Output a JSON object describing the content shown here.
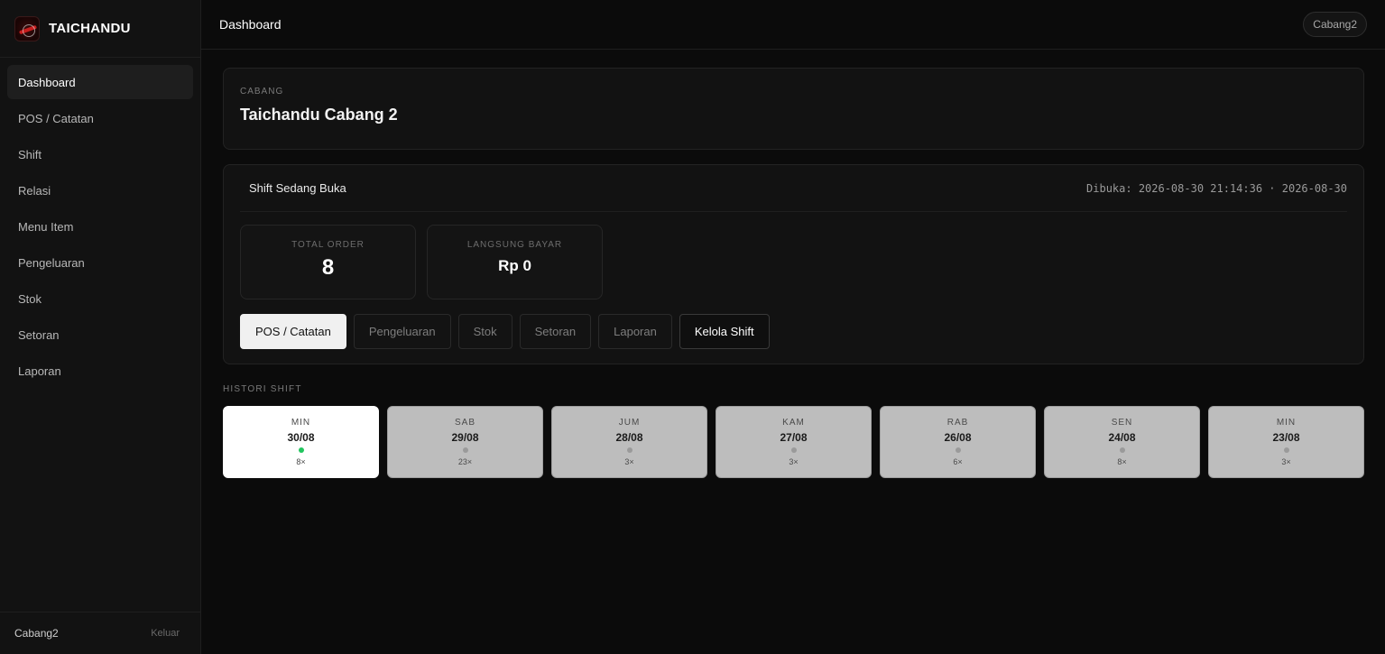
{
  "brand": {
    "name": "TAICHANDU"
  },
  "sidebar": {
    "items": [
      {
        "label": "Dashboard",
        "active": true
      },
      {
        "label": "POS / Catatan"
      },
      {
        "label": "Shift"
      },
      {
        "label": "Relasi"
      },
      {
        "label": "Menu Item"
      },
      {
        "label": "Pengeluaran"
      },
      {
        "label": "Stok"
      },
      {
        "label": "Setoran"
      },
      {
        "label": "Laporan"
      }
    ],
    "footer": {
      "user": "Cabang2",
      "logout": "Keluar"
    }
  },
  "topbar": {
    "title": "Dashboard",
    "branch_pill": "Cabang2"
  },
  "branch": {
    "label": "CABANG",
    "name": "Taichandu Cabang 2"
  },
  "shift": {
    "status": "Shift Sedang Buka",
    "opened": "Dibuka: 2026-08-30 21:14:36 · 2026-08-30",
    "stats": [
      {
        "label": "TOTAL ORDER",
        "value": "8"
      },
      {
        "label": "LANGSUNG BAYAR",
        "value": "Rp 0"
      }
    ],
    "actions": [
      {
        "label": "POS / Catatan"
      },
      {
        "label": "Pengeluaran"
      },
      {
        "label": "Stok"
      },
      {
        "label": "Setoran"
      },
      {
        "label": "Laporan"
      },
      {
        "label": "Kelola Shift"
      }
    ]
  },
  "history": {
    "label": "HISTORI SHIFT",
    "days": [
      {
        "day": "MIN",
        "date": "30/08",
        "count": "8×",
        "active": true
      },
      {
        "day": "SAB",
        "date": "29/08",
        "count": "23×"
      },
      {
        "day": "JUM",
        "date": "28/08",
        "count": "3×"
      },
      {
        "day": "KAM",
        "date": "27/08",
        "count": "3×"
      },
      {
        "day": "RAB",
        "date": "26/08",
        "count": "6×"
      },
      {
        "day": "SEN",
        "date": "24/08",
        "count": "8×"
      },
      {
        "day": "MIN",
        "date": "23/08",
        "count": "3×"
      }
    ]
  },
  "colors": {
    "accent_dot_active": "#22c55e",
    "brand_red": "#c81e1e"
  }
}
